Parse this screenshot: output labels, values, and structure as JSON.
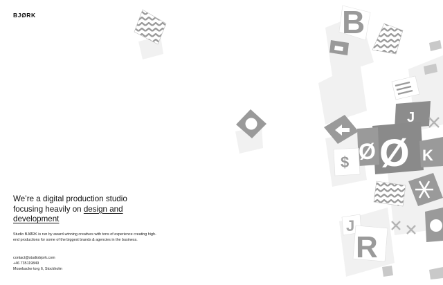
{
  "header": {
    "logo": "BJØRK"
  },
  "hero": {
    "headline_part1": "We’re a digital production studio focusing heavily on ",
    "headline_link": "design and development"
  },
  "about": {
    "description": "Studio BJØRK is run by award-winning creatives with tons of experience creating high-end productions for some of the biggest brands & agencies in the business."
  },
  "contact": {
    "email": "contact@studiobjork.com",
    "phone": "+46 735119849",
    "address": "Mosebacke torg 6, Stockholm"
  },
  "art": {
    "letters": [
      "B",
      "Ø",
      "Ø",
      "R",
      "J",
      "K",
      "$"
    ],
    "icons": [
      "chevron-pattern-icon",
      "circle-icon",
      "arrow-left-icon",
      "asterisk-icon",
      "x-icon",
      "lines-icon"
    ],
    "colors": {
      "cube": "#9a9a9a",
      "cube_dark": "#7d7d7d",
      "shadow": "#efefef",
      "glyph": "#ffffff"
    }
  }
}
